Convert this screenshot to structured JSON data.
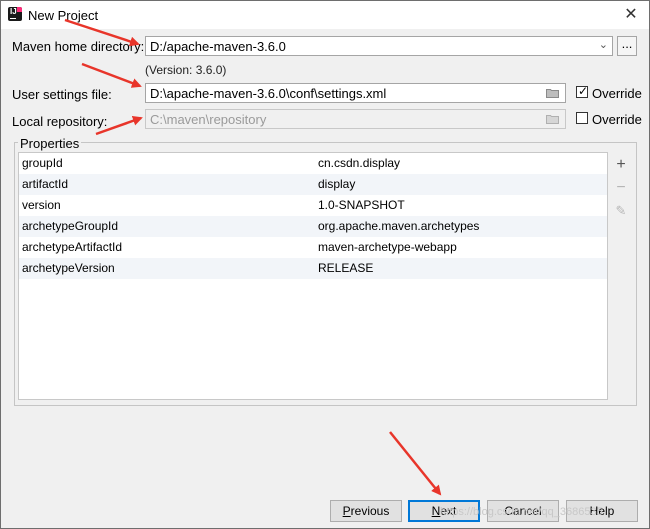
{
  "window": {
    "title": "New Project",
    "close_symbol": "✕"
  },
  "maven": {
    "home_label": "Maven home directory:",
    "home_value": "D:/apache-maven-3.6.0",
    "version_note": "(Version: 3.6.0)",
    "browse_label": "...",
    "settings_label": "User settings file:",
    "settings_value": "D:\\apache-maven-3.6.0\\conf\\settings.xml",
    "settings_override_label": "Override",
    "settings_override_checked": true,
    "repo_label": "Local repository:",
    "repo_value": "C:\\maven\\repository",
    "repo_override_label": "Override",
    "repo_override_checked": false
  },
  "properties": {
    "title": "Properties",
    "rows": [
      {
        "key": "groupId",
        "value": "cn.csdn.display"
      },
      {
        "key": "artifactId",
        "value": "display"
      },
      {
        "key": "version",
        "value": "1.0-SNAPSHOT"
      },
      {
        "key": "archetypeGroupId",
        "value": "org.apache.maven.archetypes"
      },
      {
        "key": "archetypeArtifactId",
        "value": "maven-archetype-webapp"
      },
      {
        "key": "archetypeVersion",
        "value": "RELEASE"
      }
    ],
    "tools": {
      "add": "+",
      "remove": "−",
      "edit": "✎"
    }
  },
  "buttons": {
    "previous_prefix": "",
    "previous_mnemonic": "P",
    "previous_rest": "revious",
    "next_prefix": "",
    "next_mnemonic": "N",
    "next_rest": "ext",
    "cancel_label": "Cancel",
    "help_label": "Help"
  },
  "watermark": "https://blog.csdn.net/qq_3686535",
  "colors": {
    "accent": "#0078d7",
    "arrow": "#e8352a",
    "alt_row": "#f2f5f9"
  }
}
